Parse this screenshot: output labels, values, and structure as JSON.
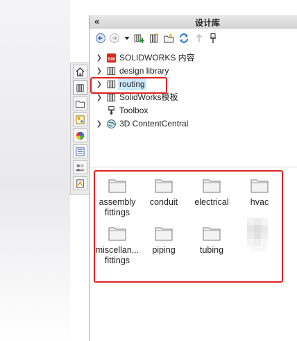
{
  "pane": {
    "collapse_glyph": "«",
    "title": "设计库"
  },
  "toolbar": {
    "buttons": [
      {
        "icon": "back-arrow-icon"
      },
      {
        "icon": "forward-arrow-icon"
      },
      {
        "icon": "dropdown-arrow-icon"
      },
      {
        "icon": "add-to-library-icon"
      },
      {
        "icon": "add-file-location-icon"
      },
      {
        "icon": "create-new-folder-icon"
      },
      {
        "icon": "refresh-icon"
      },
      {
        "icon": "up-level-icon"
      },
      {
        "icon": "pin-icon"
      }
    ]
  },
  "tree": {
    "items": [
      {
        "label": "SOLIDWORKS 内容",
        "icon": "solidworks-content-icon",
        "expandable": true
      },
      {
        "label": "design library",
        "icon": "library-book-icon",
        "expandable": true
      },
      {
        "label": "routing",
        "icon": "library-book-icon",
        "expandable": true,
        "selected": true
      },
      {
        "label": "SolidWorks模板",
        "icon": "library-book-icon",
        "expandable": true
      },
      {
        "label": "Toolbox",
        "icon": "toolbox-icon",
        "expandable": false
      },
      {
        "label": "3D ContentCentral",
        "icon": "globe-icon",
        "expandable": true
      }
    ]
  },
  "folders": {
    "items": [
      {
        "line1": "assembly",
        "line2": "fittings"
      },
      {
        "line1": "conduit",
        "line2": ""
      },
      {
        "line1": "electrical",
        "line2": ""
      },
      {
        "line1": "hvac",
        "line2": ""
      },
      {
        "line1": "miscellan...",
        "line2": "fittings"
      },
      {
        "line1": "piping",
        "line2": ""
      },
      {
        "line1": "tubing",
        "line2": ""
      }
    ]
  },
  "side_tabs": [
    {
      "icon": "home-icon"
    },
    {
      "icon": "design-library-tab-icon",
      "active": true
    },
    {
      "icon": "file-explorer-icon"
    },
    {
      "icon": "view-palette-icon"
    },
    {
      "icon": "appearances-icon"
    },
    {
      "icon": "custom-properties-icon"
    },
    {
      "icon": "solidworks-forum-icon"
    },
    {
      "icon": "routing-library-icon"
    }
  ],
  "colors": {
    "highlight_red": "#e02020",
    "selection_blue": "#cde8ff",
    "folder_fill": "#f3f3f3",
    "folder_stroke": "#7a7a7a"
  }
}
